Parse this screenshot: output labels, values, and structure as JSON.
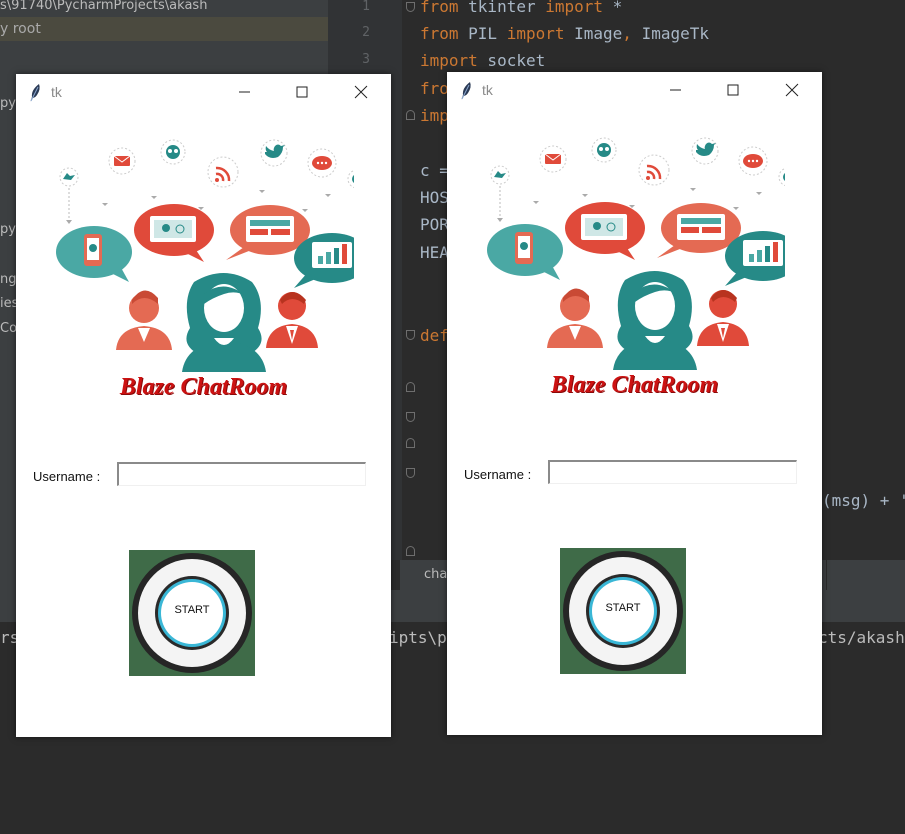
{
  "ide": {
    "path_fragment": "s\\91740\\PycharmProjects\\akash",
    "selected_item": "y root",
    "side_items": [
      "py",
      "py",
      "ng",
      "ies",
      "Co"
    ],
    "line_numbers": [
      "1",
      "2",
      "3"
    ],
    "code": {
      "l1_kw1": "from",
      "l1_mod": " tkinter ",
      "l1_kw2": "import",
      "l1_rest": " *",
      "l2_kw1": "from",
      "l2_mod": " PIL ",
      "l2_kw2": "import",
      "l2_rest": " Image",
      "l2_comma": ",",
      "l2_rest2": " ImageTk",
      "l3_kw1": "import",
      "l3_rest": " socket",
      "l4_kw": "fro",
      "l5_kw": "imp",
      "l6": "c =",
      "l7": "HOS",
      "l8": "POR",
      "l9": "HEA",
      "l10_kw": "def",
      "l11": "(msg) + '"
    },
    "tab_label": "cha",
    "terminal": {
      "left": "rs",
      "mid": "ipts\\p",
      "right": "cts/akash"
    }
  },
  "windows": [
    {
      "title": "tk",
      "brand": "Blaze ChatRoom",
      "username_label": "Username :",
      "username_value": "",
      "start_label": "START"
    },
    {
      "title": "tk",
      "brand": "Blaze ChatRoom",
      "username_label": "Username :",
      "username_value": "",
      "start_label": "START"
    }
  ],
  "icons": [
    "feather-icon",
    "minimize-icon",
    "maximize-icon",
    "close-icon"
  ],
  "colors": {
    "brand_red": "#cc1212",
    "button_green": "#3f6b48",
    "ring_cyan": "#3ab7d6",
    "teal": "#268a87",
    "coral": "#e46a53"
  }
}
